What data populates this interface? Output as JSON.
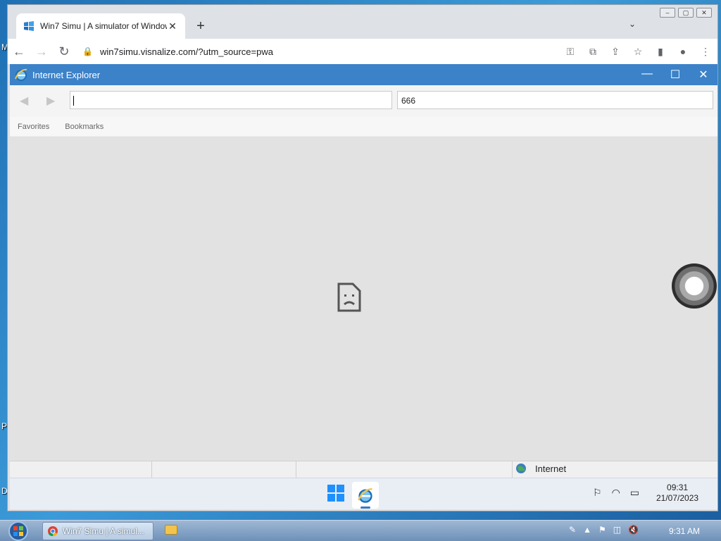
{
  "desktop": {
    "edge_letters": [
      "M",
      "P",
      "D"
    ]
  },
  "chrome": {
    "tab": {
      "title": "Win7 Simu | A simulator of Windows",
      "close": "✕"
    },
    "new_tab": "+",
    "tab_list": "⌄",
    "window_controls": [
      "–",
      "▢",
      "✕"
    ],
    "url": "win7simu.visnalize.com/?utm_source=pwa",
    "lock_glyph": "🔒",
    "nav": {
      "back": "←",
      "forward": "→",
      "reload": "↻"
    },
    "icons": [
      "key-icon",
      "open-in-app-icon",
      "share-icon",
      "bookmark-star-icon",
      "side-panel-icon",
      "profile-icon",
      "menu-icon"
    ]
  },
  "ie": {
    "title": "Internet Explorer",
    "controls": {
      "minimize": "—",
      "maximize": "☐",
      "close": "✕"
    },
    "address_value": "",
    "search_value": "666",
    "favorites_bar": {
      "favorites": "Favorites",
      "bookmarks": "Bookmarks"
    },
    "status": {
      "zone": "Internet"
    },
    "clock": {
      "time": "09:31",
      "date": "21/07/2023"
    }
  },
  "win7": {
    "task_label": "Win7 Simu | A simul...",
    "clock": "9:31 AM"
  },
  "colors": {
    "ie_title": "#3c82c9",
    "chrome_frame": "#dee1e6",
    "content_bg": "#e2e2e2"
  }
}
